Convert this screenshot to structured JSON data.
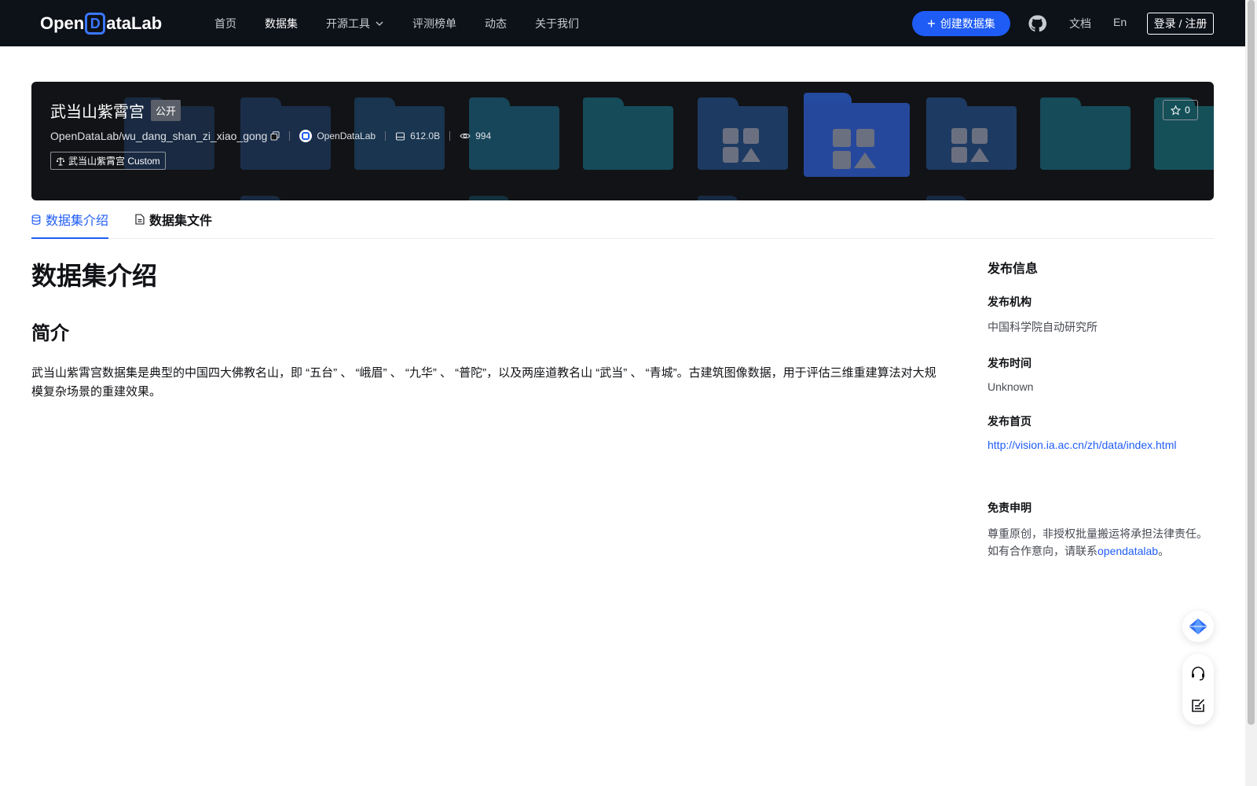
{
  "navbar": {
    "logo_pre": "Open",
    "logo_d": "D",
    "logo_post": "ataLab",
    "links": [
      {
        "label": "首页"
      },
      {
        "label": "数据集"
      },
      {
        "label": "开源工具"
      },
      {
        "label": "评测榜单"
      },
      {
        "label": "动态"
      },
      {
        "label": "关于我们"
      }
    ],
    "active_link": "数据集",
    "create_label": "创建数据集",
    "docs_label": "文档",
    "lang_label": "En",
    "login_label": "登录 / 注册"
  },
  "banner": {
    "title": "武当山紫霄宫",
    "badge": "公开",
    "repo_path": "OpenDataLab/wu_dang_shan_zi_xiao_gong",
    "org": "OpenDataLab",
    "size": "612.0B",
    "views": "994",
    "license": "武当山紫霄宫 Custom",
    "stars": "0"
  },
  "tabs": [
    {
      "label": "数据集介绍",
      "active": true
    },
    {
      "label": "数据集文件",
      "active": false
    }
  ],
  "content": {
    "heading": "数据集介绍",
    "subheading": "简介",
    "paragraph": "武当山紫霄宫数据集是典型的中国四大佛教名山，即 “五台” 、 “峨眉” 、 “九华” 、 “普陀”，以及两座道教名山 “武当” 、 “青城”。古建筑图像数据，用于评估三维重建算法对大规模复杂场景的重建效果。"
  },
  "sidebar": {
    "title": "发布信息",
    "org_label": "发布机构",
    "org_value": "中国科学院自动研究所",
    "time_label": "发布时间",
    "time_value": "Unknown",
    "home_label": "发布首页",
    "home_value": "http://vision.ia.ac.cn/zh/data/index.html",
    "disclaimer_label": "免责申明",
    "disclaimer_line1": "尊重原创，非授权批量搬运将承担法律责任。",
    "disclaimer_line2_pre": "如有合作意向，请联系",
    "disclaimer_link": "opendatalab",
    "disclaimer_line2_post": "。"
  },
  "colors": {
    "accent": "#1f5cf5",
    "navbar_bg": "#0d1118",
    "banner_bg": "#121316"
  }
}
